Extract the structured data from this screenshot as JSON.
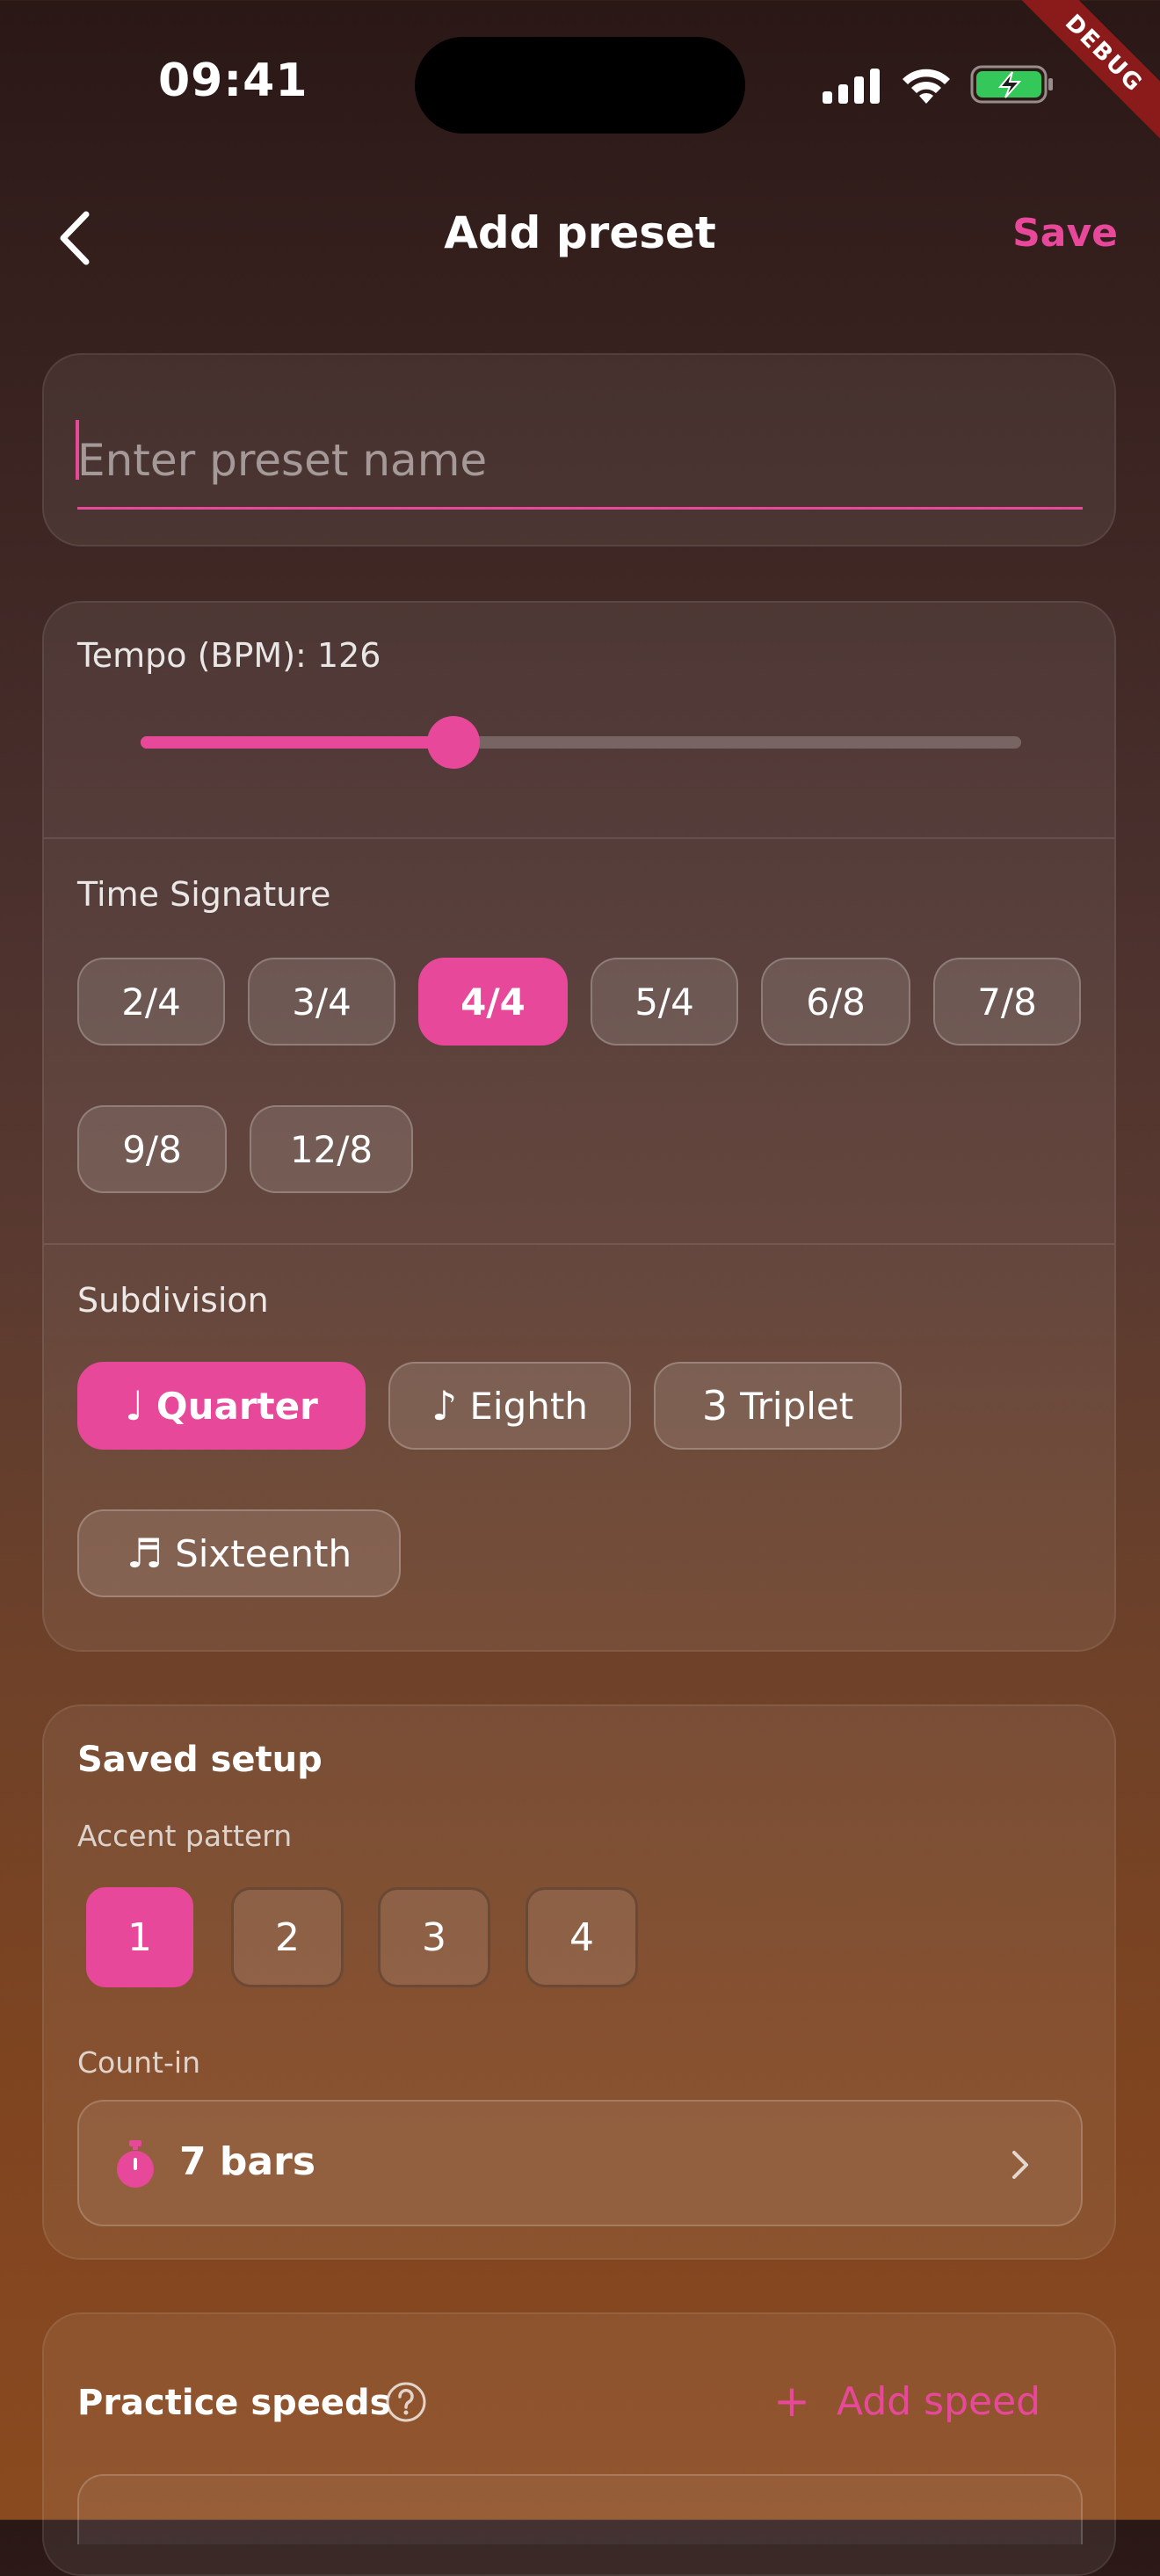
{
  "status_bar": {
    "time": "09:41",
    "debug_banner": "DEBUG"
  },
  "app_bar": {
    "title": "Add preset",
    "save_label": "Save"
  },
  "preset_name": {
    "placeholder": "Enter preset name",
    "value": ""
  },
  "tempo": {
    "label": "Tempo (BPM): 126",
    "value": 126,
    "slider_fraction": 0.36
  },
  "time_signature": {
    "label": "Time Signature",
    "options": [
      "2/4",
      "3/4",
      "4/4",
      "5/4",
      "6/8",
      "7/8",
      "9/8",
      "12/8"
    ],
    "selected": "4/4"
  },
  "subdivision": {
    "label": "Subdivision",
    "options": [
      {
        "glyph": "♩",
        "label": "Quarter"
      },
      {
        "glyph": "♪",
        "label": "Eighth"
      },
      {
        "glyph": "3",
        "label": "Triplet"
      },
      {
        "glyph": "♬",
        "label": "Sixteenth"
      }
    ],
    "selected": "Quarter"
  },
  "saved_setup": {
    "title": "Saved setup",
    "accent_label": "Accent pattern",
    "beats": [
      "1",
      "2",
      "3",
      "4"
    ],
    "accented_beat": "1",
    "count_in_label": "Count-in",
    "count_in_value": "7 bars"
  },
  "practice_speeds": {
    "title": "Practice speeds",
    "add_plus": "+",
    "add_label": "Add speed"
  },
  "colors": {
    "accent": "#e8489a",
    "battery_green": "#34c759",
    "debug_red": "#8b1a1a"
  },
  "icons": {
    "back": "chevron-left-icon",
    "signal": "cellular-signal-icon",
    "wifi": "wifi-icon",
    "battery": "battery-charging-icon",
    "timer": "stopwatch-icon",
    "chevron": "chevron-right-icon",
    "help": "question-circle-icon"
  }
}
